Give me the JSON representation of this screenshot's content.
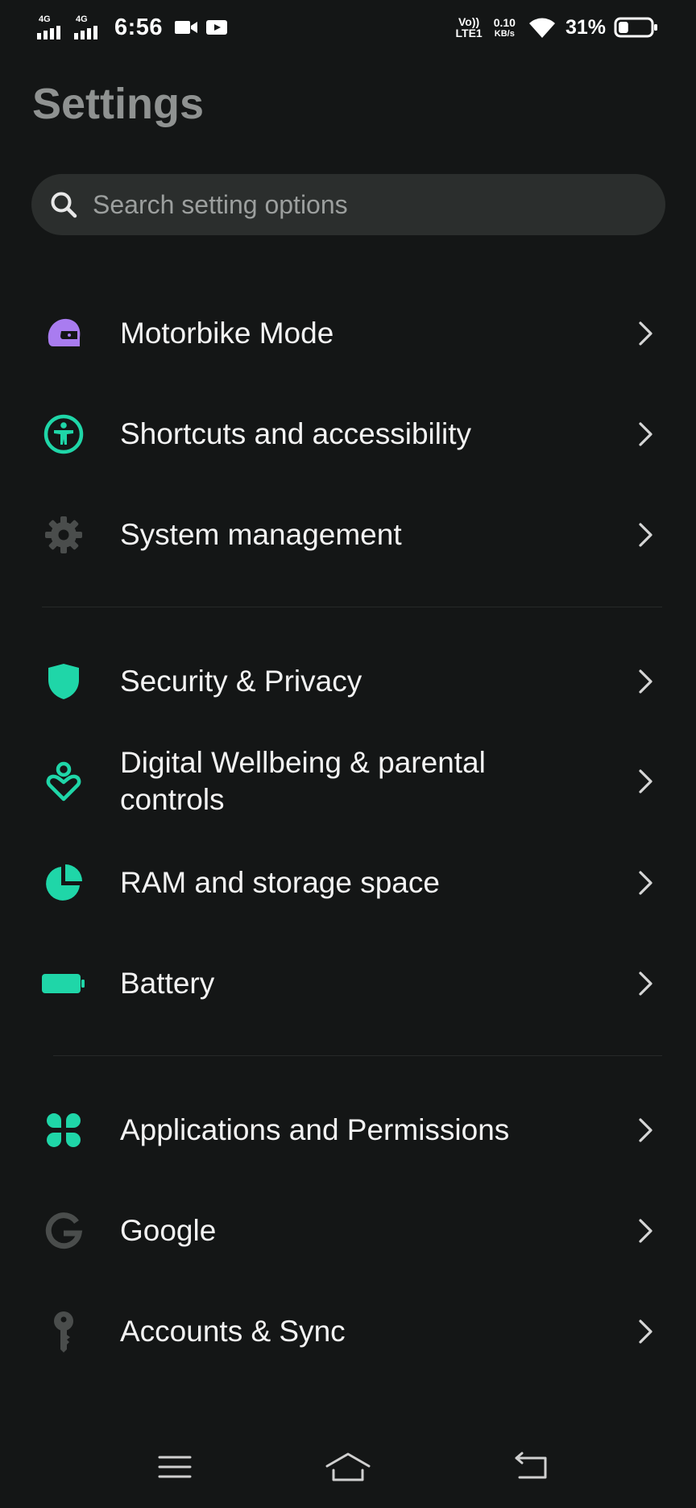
{
  "status_bar": {
    "sim1_network": "4G",
    "sim2_network": "4G",
    "time": "6:56",
    "volte_top": "Vo))",
    "volte_bottom": "LTE1",
    "net_speed_value": "0.10",
    "net_speed_unit": "KB/s",
    "battery_percent": "31%",
    "battery_level": 0.31
  },
  "header": {
    "title": "Settings"
  },
  "search": {
    "placeholder": "Search setting options"
  },
  "settings": {
    "items": [
      {
        "label": "Motorbike Mode",
        "icon": "helmet-icon",
        "color": "#a97cf0"
      },
      {
        "label": "Shortcuts and accessibility",
        "icon": "accessibility-icon",
        "color": "#1fd6a8"
      },
      {
        "label": "System management",
        "icon": "gear-icon",
        "color": "#4a4d4c"
      },
      {
        "label": "Security & Privacy",
        "icon": "shield-icon",
        "color": "#1fd6a8"
      },
      {
        "label": "Digital Wellbeing & parental controls",
        "label_line1": "Digital Wellbeing & parental",
        "label_line2": "controls",
        "icon": "wellbeing-icon",
        "color": "#1fd6a8"
      },
      {
        "label": "RAM and storage space",
        "icon": "pie-chart-icon",
        "color": "#1fd6a8"
      },
      {
        "label": "Battery",
        "icon": "battery-icon",
        "color": "#1fd6a8"
      },
      {
        "label": "Applications and Permissions",
        "icon": "apps-grid-icon",
        "color": "#1fd6a8"
      },
      {
        "label": "Google",
        "icon": "google-icon",
        "color": "#4a4d4c"
      },
      {
        "label": "Accounts & Sync",
        "icon": "key-icon",
        "color": "#4a4d4c"
      }
    ]
  },
  "colors": {
    "background": "#141616",
    "accent": "#1fd6a8",
    "accent_purple": "#a97cf0",
    "muted_icon": "#4a4d4c",
    "title": "#8f9291",
    "search_bg": "#2b2e2d"
  },
  "nav_bar": {
    "recents": "menu-icon",
    "home": "home-icon",
    "back": "back-icon"
  }
}
